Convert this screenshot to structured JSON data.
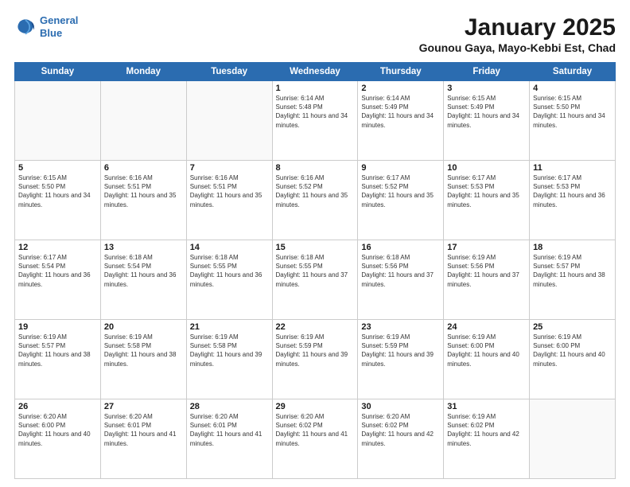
{
  "logo": {
    "line1": "General",
    "line2": "Blue"
  },
  "title": "January 2025",
  "subtitle": "Gounou Gaya, Mayo-Kebbi Est, Chad",
  "days_of_week": [
    "Sunday",
    "Monday",
    "Tuesday",
    "Wednesday",
    "Thursday",
    "Friday",
    "Saturday"
  ],
  "weeks": [
    [
      {
        "day": "",
        "info": ""
      },
      {
        "day": "",
        "info": ""
      },
      {
        "day": "",
        "info": ""
      },
      {
        "day": "1",
        "info": "Sunrise: 6:14 AM\nSunset: 5:48 PM\nDaylight: 11 hours and 34 minutes."
      },
      {
        "day": "2",
        "info": "Sunrise: 6:14 AM\nSunset: 5:49 PM\nDaylight: 11 hours and 34 minutes."
      },
      {
        "day": "3",
        "info": "Sunrise: 6:15 AM\nSunset: 5:49 PM\nDaylight: 11 hours and 34 minutes."
      },
      {
        "day": "4",
        "info": "Sunrise: 6:15 AM\nSunset: 5:50 PM\nDaylight: 11 hours and 34 minutes."
      }
    ],
    [
      {
        "day": "5",
        "info": "Sunrise: 6:15 AM\nSunset: 5:50 PM\nDaylight: 11 hours and 34 minutes."
      },
      {
        "day": "6",
        "info": "Sunrise: 6:16 AM\nSunset: 5:51 PM\nDaylight: 11 hours and 35 minutes."
      },
      {
        "day": "7",
        "info": "Sunrise: 6:16 AM\nSunset: 5:51 PM\nDaylight: 11 hours and 35 minutes."
      },
      {
        "day": "8",
        "info": "Sunrise: 6:16 AM\nSunset: 5:52 PM\nDaylight: 11 hours and 35 minutes."
      },
      {
        "day": "9",
        "info": "Sunrise: 6:17 AM\nSunset: 5:52 PM\nDaylight: 11 hours and 35 minutes."
      },
      {
        "day": "10",
        "info": "Sunrise: 6:17 AM\nSunset: 5:53 PM\nDaylight: 11 hours and 35 minutes."
      },
      {
        "day": "11",
        "info": "Sunrise: 6:17 AM\nSunset: 5:53 PM\nDaylight: 11 hours and 36 minutes."
      }
    ],
    [
      {
        "day": "12",
        "info": "Sunrise: 6:17 AM\nSunset: 5:54 PM\nDaylight: 11 hours and 36 minutes."
      },
      {
        "day": "13",
        "info": "Sunrise: 6:18 AM\nSunset: 5:54 PM\nDaylight: 11 hours and 36 minutes."
      },
      {
        "day": "14",
        "info": "Sunrise: 6:18 AM\nSunset: 5:55 PM\nDaylight: 11 hours and 36 minutes."
      },
      {
        "day": "15",
        "info": "Sunrise: 6:18 AM\nSunset: 5:55 PM\nDaylight: 11 hours and 37 minutes."
      },
      {
        "day": "16",
        "info": "Sunrise: 6:18 AM\nSunset: 5:56 PM\nDaylight: 11 hours and 37 minutes."
      },
      {
        "day": "17",
        "info": "Sunrise: 6:19 AM\nSunset: 5:56 PM\nDaylight: 11 hours and 37 minutes."
      },
      {
        "day": "18",
        "info": "Sunrise: 6:19 AM\nSunset: 5:57 PM\nDaylight: 11 hours and 38 minutes."
      }
    ],
    [
      {
        "day": "19",
        "info": "Sunrise: 6:19 AM\nSunset: 5:57 PM\nDaylight: 11 hours and 38 minutes."
      },
      {
        "day": "20",
        "info": "Sunrise: 6:19 AM\nSunset: 5:58 PM\nDaylight: 11 hours and 38 minutes."
      },
      {
        "day": "21",
        "info": "Sunrise: 6:19 AM\nSunset: 5:58 PM\nDaylight: 11 hours and 39 minutes."
      },
      {
        "day": "22",
        "info": "Sunrise: 6:19 AM\nSunset: 5:59 PM\nDaylight: 11 hours and 39 minutes."
      },
      {
        "day": "23",
        "info": "Sunrise: 6:19 AM\nSunset: 5:59 PM\nDaylight: 11 hours and 39 minutes."
      },
      {
        "day": "24",
        "info": "Sunrise: 6:19 AM\nSunset: 6:00 PM\nDaylight: 11 hours and 40 minutes."
      },
      {
        "day": "25",
        "info": "Sunrise: 6:19 AM\nSunset: 6:00 PM\nDaylight: 11 hours and 40 minutes."
      }
    ],
    [
      {
        "day": "26",
        "info": "Sunrise: 6:20 AM\nSunset: 6:00 PM\nDaylight: 11 hours and 40 minutes."
      },
      {
        "day": "27",
        "info": "Sunrise: 6:20 AM\nSunset: 6:01 PM\nDaylight: 11 hours and 41 minutes."
      },
      {
        "day": "28",
        "info": "Sunrise: 6:20 AM\nSunset: 6:01 PM\nDaylight: 11 hours and 41 minutes."
      },
      {
        "day": "29",
        "info": "Sunrise: 6:20 AM\nSunset: 6:02 PM\nDaylight: 11 hours and 41 minutes."
      },
      {
        "day": "30",
        "info": "Sunrise: 6:20 AM\nSunset: 6:02 PM\nDaylight: 11 hours and 42 minutes."
      },
      {
        "day": "31",
        "info": "Sunrise: 6:19 AM\nSunset: 6:02 PM\nDaylight: 11 hours and 42 minutes."
      },
      {
        "day": "",
        "info": ""
      }
    ]
  ]
}
